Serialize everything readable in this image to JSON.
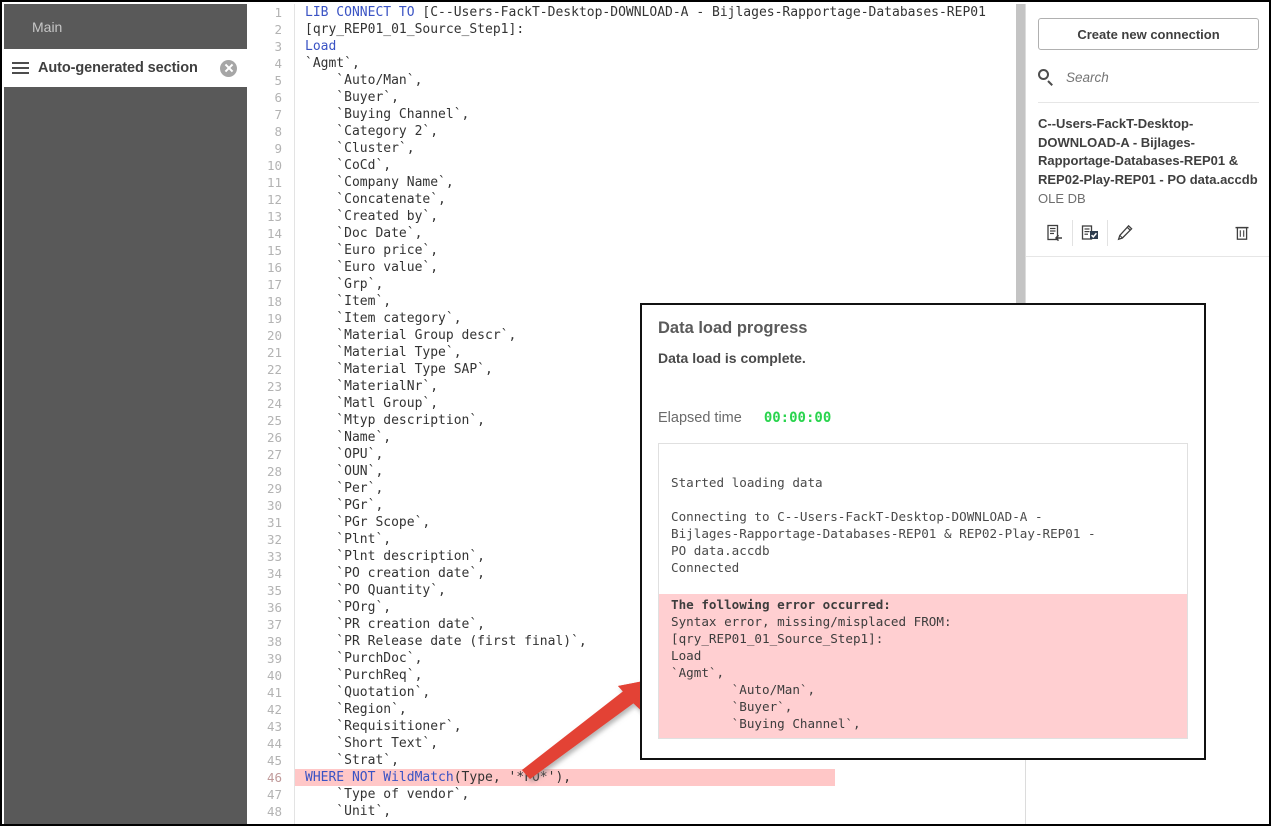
{
  "sidebar": {
    "main_label": "Main",
    "section_label": "Auto-generated section",
    "menu_icon": "hamburger-icon",
    "close_icon": "close-circle-icon"
  },
  "editor": {
    "lines": [
      {
        "n": "1",
        "parts": [
          {
            "t": "LIB CONNECT TO ",
            "k": true
          },
          {
            "t": "[C--Users-FackT-Desktop-DOWNLOAD-A - Bijlages-Rapportage-Databases-REP01",
            "k": false
          }
        ]
      },
      {
        "n": "2",
        "parts": [
          {
            "t": "[qry_REP01_01_Source_Step1]:",
            "k": false
          }
        ]
      },
      {
        "n": "3",
        "parts": [
          {
            "t": "Load",
            "k": true
          }
        ]
      },
      {
        "n": "4",
        "parts": [
          {
            "t": "`Agmt`,",
            "k": false
          }
        ]
      },
      {
        "n": "5",
        "parts": [
          {
            "t": "    `Auto/Man`,",
            "k": false
          }
        ]
      },
      {
        "n": "6",
        "parts": [
          {
            "t": "    `Buyer`,",
            "k": false
          }
        ]
      },
      {
        "n": "7",
        "parts": [
          {
            "t": "    `Buying Channel`,",
            "k": false
          }
        ]
      },
      {
        "n": "8",
        "parts": [
          {
            "t": "    `Category 2`,",
            "k": false
          }
        ]
      },
      {
        "n": "9",
        "parts": [
          {
            "t": "    `Cluster`,",
            "k": false
          }
        ]
      },
      {
        "n": "10",
        "parts": [
          {
            "t": "    `CoCd`,",
            "k": false
          }
        ]
      },
      {
        "n": "11",
        "parts": [
          {
            "t": "    `Company Name`,",
            "k": false
          }
        ]
      },
      {
        "n": "12",
        "parts": [
          {
            "t": "    `Concatenate`,",
            "k": false
          }
        ]
      },
      {
        "n": "13",
        "parts": [
          {
            "t": "    `Created by`,",
            "k": false
          }
        ]
      },
      {
        "n": "14",
        "parts": [
          {
            "t": "    `Doc Date`,",
            "k": false
          }
        ]
      },
      {
        "n": "15",
        "parts": [
          {
            "t": "    `Euro price`,",
            "k": false
          }
        ]
      },
      {
        "n": "16",
        "parts": [
          {
            "t": "    `Euro value`,",
            "k": false
          }
        ]
      },
      {
        "n": "17",
        "parts": [
          {
            "t": "    `Grp`,",
            "k": false
          }
        ]
      },
      {
        "n": "18",
        "parts": [
          {
            "t": "    `Item`,",
            "k": false
          }
        ]
      },
      {
        "n": "19",
        "parts": [
          {
            "t": "    `Item category`,",
            "k": false
          }
        ]
      },
      {
        "n": "20",
        "parts": [
          {
            "t": "    `Material Group descr`,",
            "k": false
          }
        ]
      },
      {
        "n": "21",
        "parts": [
          {
            "t": "    `Material Type`,",
            "k": false
          }
        ]
      },
      {
        "n": "22",
        "parts": [
          {
            "t": "    `Material Type SAP`,",
            "k": false
          }
        ]
      },
      {
        "n": "23",
        "parts": [
          {
            "t": "    `MaterialNr`,",
            "k": false
          }
        ]
      },
      {
        "n": "24",
        "parts": [
          {
            "t": "    `Matl Group`,",
            "k": false
          }
        ]
      },
      {
        "n": "25",
        "parts": [
          {
            "t": "    `Mtyp description`,",
            "k": false
          }
        ]
      },
      {
        "n": "26",
        "parts": [
          {
            "t": "    `Name`,",
            "k": false
          }
        ]
      },
      {
        "n": "27",
        "parts": [
          {
            "t": "    `OPU`,",
            "k": false
          }
        ]
      },
      {
        "n": "28",
        "parts": [
          {
            "t": "    `OUN`,",
            "k": false
          }
        ]
      },
      {
        "n": "29",
        "parts": [
          {
            "t": "    `Per`,",
            "k": false
          }
        ]
      },
      {
        "n": "30",
        "parts": [
          {
            "t": "    `PGr`,",
            "k": false
          }
        ]
      },
      {
        "n": "31",
        "parts": [
          {
            "t": "    `PGr Scope`,",
            "k": false
          }
        ]
      },
      {
        "n": "32",
        "parts": [
          {
            "t": "    `Plnt`,",
            "k": false
          }
        ]
      },
      {
        "n": "33",
        "parts": [
          {
            "t": "    `Plnt description`,",
            "k": false
          }
        ]
      },
      {
        "n": "34",
        "parts": [
          {
            "t": "    `PO creation date`,",
            "k": false
          }
        ]
      },
      {
        "n": "35",
        "parts": [
          {
            "t": "    `PO Quantity`,",
            "k": false
          }
        ]
      },
      {
        "n": "36",
        "parts": [
          {
            "t": "    `POrg`,",
            "k": false
          }
        ]
      },
      {
        "n": "37",
        "parts": [
          {
            "t": "    `PR creation date`,",
            "k": false
          }
        ]
      },
      {
        "n": "38",
        "parts": [
          {
            "t": "    `PR Release date (first final)`,",
            "k": false
          }
        ]
      },
      {
        "n": "39",
        "parts": [
          {
            "t": "    `PurchDoc`,",
            "k": false
          }
        ]
      },
      {
        "n": "40",
        "parts": [
          {
            "t": "    `PurchReq`,",
            "k": false
          }
        ]
      },
      {
        "n": "41",
        "parts": [
          {
            "t": "    `Quotation`,",
            "k": false
          }
        ]
      },
      {
        "n": "42",
        "parts": [
          {
            "t": "    `Region`,",
            "k": false
          }
        ]
      },
      {
        "n": "43",
        "parts": [
          {
            "t": "    `Requisitioner`,",
            "k": false
          }
        ]
      },
      {
        "n": "44",
        "parts": [
          {
            "t": "    `Short Text`,",
            "k": false
          }
        ]
      },
      {
        "n": "45",
        "parts": [
          {
            "t": "    `Strat`,",
            "k": false
          }
        ]
      },
      {
        "n": "46",
        "highlight": true,
        "parts": [
          {
            "t": "WHERE NOT WildMatch",
            "k": true
          },
          {
            "t": "(Type, '*FO*'),",
            "k": false
          }
        ]
      },
      {
        "n": "47",
        "parts": [
          {
            "t": "    `Type of vendor`,",
            "k": false
          }
        ]
      },
      {
        "n": "48",
        "parts": [
          {
            "t": "    `Unit`,",
            "k": false
          }
        ]
      }
    ]
  },
  "connections": {
    "create_button": "Create new connection",
    "search_placeholder": "Search",
    "search_value": "",
    "search_icon": "search-icon",
    "item": {
      "name": "C--Users-FackT-Desktop-DOWNLOAD-A - Bijlages-Rapportage-Databases-REP01 & REP02-Play-REP01 - PO data.accdb",
      "type": "OLE DB",
      "actions": [
        {
          "icon": "insert-connection-string-icon",
          "label": "Insert connection string"
        },
        {
          "icon": "select-data-icon",
          "label": "Select data"
        },
        {
          "icon": "edit-pencil-icon",
          "label": "Edit connection"
        },
        {
          "icon": "delete-trash-icon",
          "label": "Delete"
        }
      ]
    }
  },
  "dialog": {
    "title": "Data load progress",
    "status": "Data load is complete.",
    "elapsed_label": "Elapsed time",
    "elapsed_value": "00:00:00",
    "elapsed_color": "#2ad44e",
    "log": {
      "started": "Started loading data",
      "connecting": "Connecting to C--Users-FackT-Desktop-DOWNLOAD-A -\nBijlages-Rapportage-Databases-REP01 & REP02-Play-REP01 -\nPO data.accdb",
      "connected": "Connected",
      "error_heading": "The following error occurred:",
      "error_lines": "Syntax error, missing/misplaced FROM:\n[qry_REP01_01_Source_Step1]:\nLoad\n`Agmt`,\n        `Auto/Man`,\n        `Buyer`,\n        `Buying Channel`,",
      "error_bg": "#ffcfd1"
    }
  },
  "annotation": {
    "arrow_color": "#e34234",
    "arrow_name": "red-pointer-arrow"
  }
}
